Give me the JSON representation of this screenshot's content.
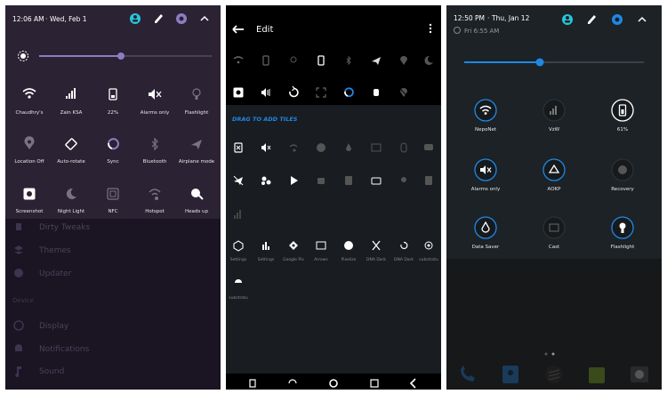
{
  "panel1": {
    "time": "12:06 AM",
    "date": "Wed, Feb 1",
    "tiles": [
      {
        "label": "Chaudhry's",
        "icon": "wifi-icon"
      },
      {
        "label": "Zain KSA",
        "icon": "signal-icon"
      },
      {
        "label": "22%",
        "icon": "battery-icon"
      },
      {
        "label": "Alarms only",
        "icon": "volume-mute-icon"
      },
      {
        "label": "Flashlight",
        "icon": "flashlight-icon"
      },
      {
        "label": "Location Off",
        "icon": "location-icon"
      },
      {
        "label": "Auto-rotate",
        "icon": "rotate-icon"
      },
      {
        "label": "Sync",
        "icon": "sync-icon"
      },
      {
        "label": "Bluetooth",
        "icon": "bluetooth-icon"
      },
      {
        "label": "Airplane mode",
        "icon": "airplane-icon"
      },
      {
        "label": "Screenshot",
        "icon": "screenshot-icon"
      },
      {
        "label": "Night Light",
        "icon": "night-light-icon"
      },
      {
        "label": "NFC",
        "icon": "nfc-icon"
      },
      {
        "label": "Hotspot",
        "icon": "hotspot-icon"
      },
      {
        "label": "Heads up",
        "icon": "heads-up-icon"
      }
    ],
    "menu": {
      "items_top": [
        "Dirty Tweaks",
        "Themes",
        "Updater"
      ],
      "section": "Device",
      "items_bottom": [
        "Display",
        "Notifications",
        "Sound"
      ]
    }
  },
  "panel2": {
    "title": "Edit",
    "drag_header": "DRAG TO ADD TILES",
    "labeled_tiles": [
      "Settings",
      "Settings",
      "Google Pix",
      "Arrows",
      "Pixelize",
      "DNA Dark",
      "DNA Dark",
      "substratu"
    ],
    "last_tile": "substratu"
  },
  "panel3": {
    "time": "12:50 PM",
    "date": "Thu, Jan 12",
    "alarm": "Fri 6:55 AM",
    "tiles": [
      {
        "label": "NepoNet",
        "icon": "wifi-icon"
      },
      {
        "label": "VzW",
        "icon": "signal-icon"
      },
      {
        "label": "61%",
        "icon": "battery-icon"
      },
      {
        "label": "Alarms only",
        "icon": "volume-mute-icon"
      },
      {
        "label": "AOKP",
        "icon": "aokp-icon"
      },
      {
        "label": "Recovery",
        "icon": "recovery-icon"
      },
      {
        "label": "Data Saver",
        "icon": "data-saver-icon"
      },
      {
        "label": "Cast",
        "icon": "cast-icon"
      },
      {
        "label": "Flashlight",
        "icon": "flashlight-icon"
      }
    ]
  },
  "colors": {
    "accent_purple": "#8e7cc3",
    "accent_blue": "#1e88e5",
    "accent_teal": "#26c6da"
  }
}
